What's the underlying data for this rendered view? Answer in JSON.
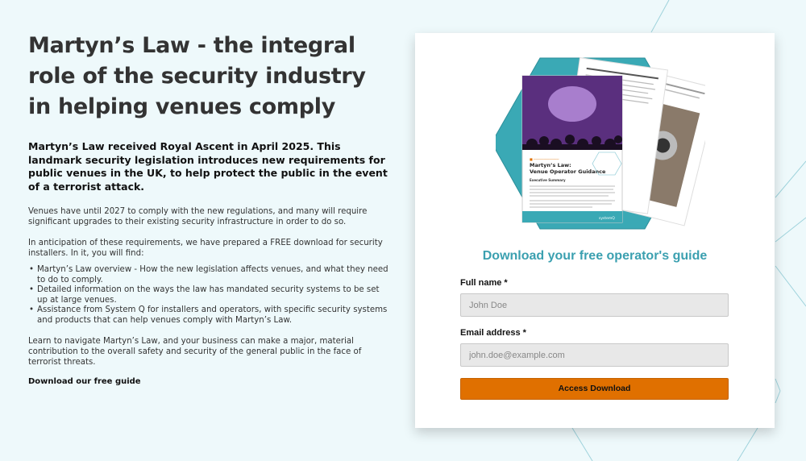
{
  "article": {
    "title": "Martyn’s Law - the integral role of the security industry in helping venues comply",
    "lead": "Martyn’s Law received Royal Ascent in April 2025. This landmark security legislation introduces new requirements for public venues in the UK, to help protect the public in the event of a terrorist attack.",
    "para1": "Venues have until 2027 to comply with the new regulations, and many will require significant upgrades to their existing security infrastructure in order to do so.",
    "para2": "In anticipation of these requirements, we have prepared a FREE download for security installers. In it, you will find:",
    "findings": [
      "Martyn’s Law overview - How the new legislation affects venues, and what they need to do to comply.",
      "Detailed information on the ways the law has mandated security systems to be set up at large venues.",
      "Assistance from System Q for installers and operators, with specific security systems and products that can help venues comply with Martyn’s Law."
    ],
    "para3": "Learn to navigate Martyn’s Law, and your business can make a major, material contribution to the overall safety and security of the general public in the face of terrorist threats.",
    "download_text": "Download our free guide"
  },
  "cover": {
    "doc_title_line1": "Martyn’s Law:",
    "doc_title_line2": "Venue Operator Guidance",
    "section": "Executive Summary",
    "brand": "systemQ"
  },
  "form": {
    "title": "Download your free operator's guide",
    "name_label": "Full name *",
    "name_placeholder": "John Doe",
    "email_label": "Email address *",
    "email_placeholder": "john.doe@example.com",
    "submit_label": "Access Download"
  },
  "colors": {
    "accent": "#3ba0b0",
    "button": "#e07000",
    "background": "#eef9fb"
  }
}
